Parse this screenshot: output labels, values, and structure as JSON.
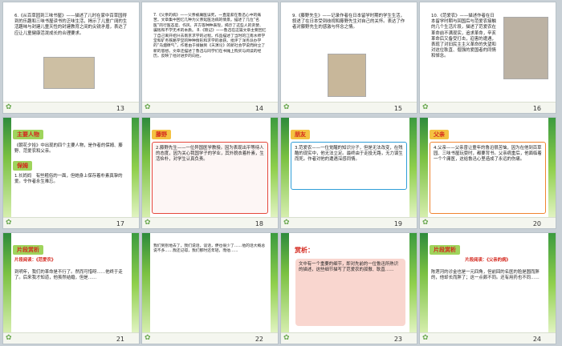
{
  "slides": [
    {
      "num": "13",
      "text": "6.《从百草园到三味书屋》——描述了儿时在家中百草园得到的乐趣和三味书屋读书的乏味生活，揭示了儿童广阔的生活趣味与封建儿童天性的封建教育之间的尖锐矛盾，表达了应让儿童健康活泼成长的合理要求。"
    },
    {
      "num": "14",
      "text": "7.《父亲的病》——父亲被庸医误死，一直是萦在鲁迅心中的痛苦。文章集中回忆几种为父亲延医治病的情景。描述了几位“名医”的行医态度、作风、开方等种种表现，揭示了这些人的贪婪、骗钱和不学无术的本质。\n8.《琐记》——鲁迅在这篇文章主要回忆了自己离开绍兴去南京求学的过程。作品描述了当时的江南水师学堂和矿务铁路学堂的种种情形和求学的收获。批评了洋务派办学的“乌烟瘴气”，作者由于接触到《天演论》的新社会学说而树立了新的思想。文章还描述了鲁迅与同学们在书摊上购买与阅读的经历，反映了他对进步的向往。"
    },
    {
      "num": "15",
      "text": "9.《藤野先生》——记录作者在日本留学时期的学生生活，叙述了在日本受到歧视和藤野先生对自己的关怀。表达了作者对藤野先生的感激与怀念之情。"
    },
    {
      "num": "16",
      "text": "10.《范爱农》——描述作者在日本留学时期与回国后与范爱农接触的几个生活片段，描述了范爱农在革命前不满现实，追求革命，辛亥革命后又备受打击，迫害的遭遇，表现了对旧民主主义革命的失望和对这位耿直、倔强的爱国者的同情和悼念。"
    },
    {
      "num": "17",
      "tag": "主要人物",
      "text": "《朝花夕拾》中出现的四个主要人物，是作者的保姆、藤野、范爱农和父亲。",
      "sub_tag": "保姆",
      "sub_text": "1.长妈妈　有些粗俗的一面，但她身上保存着朴素真挚的爱。令作者永生难忘。"
    },
    {
      "num": "18",
      "tag": "藤野",
      "text": "2.藤野先生——一位异国医学教授。因为表现出平等待人的态度，因为关心我国学子的学业，其外貌衣着朴素，生活俭朴，对学生认真负责。"
    },
    {
      "num": "19",
      "tag": "朋友",
      "text": "3.范爱农——一位觉醒的知识分子，但是无法改变，在残酷的现实中，他无法立足。最终由于走投无路，无力谋生而死。作者对他的遭遇深感同情。"
    },
    {
      "num": "20",
      "tag": "父亲",
      "text": "4.父亲——父亲曾让童年的鲁迅很苦恼，因为在他到百草园、三味书屋玩耍时，都要背书。父亲病重后，他面临着一个个庸医，这给鲁迅心里造成了永远的伤痛。"
    },
    {
      "num": "21",
      "tag": "片段赏析",
      "title": "片段阅读：《范爱农》",
      "text": "到明年，我们的革命是不行了。然而可惜呀……他终于走了。后来我才知道，他虽然结婚，但是……"
    },
    {
      "num": "22",
      "text": "我们到别地去了，我们说话，谈话，便也很少了……他的话大概总说不多……我还记得，我们那时还年轻，而他……"
    },
    {
      "num": "23",
      "tag": "赏析：",
      "text": "文中有一个重要的细节，即对先前的一位鲁迅所熟识的描述，这些细节描写了范爱农的孤傲、耿直……"
    },
    {
      "num": "24",
      "tag": "片段赏析",
      "title": "片段阅读：《父亲的病》",
      "text": "陈莲河的诊金也是一元四角，但前回的名医的脸是圆而胖的，他却长而胖了；这一点颇不同。还有用药也不同……"
    }
  ]
}
